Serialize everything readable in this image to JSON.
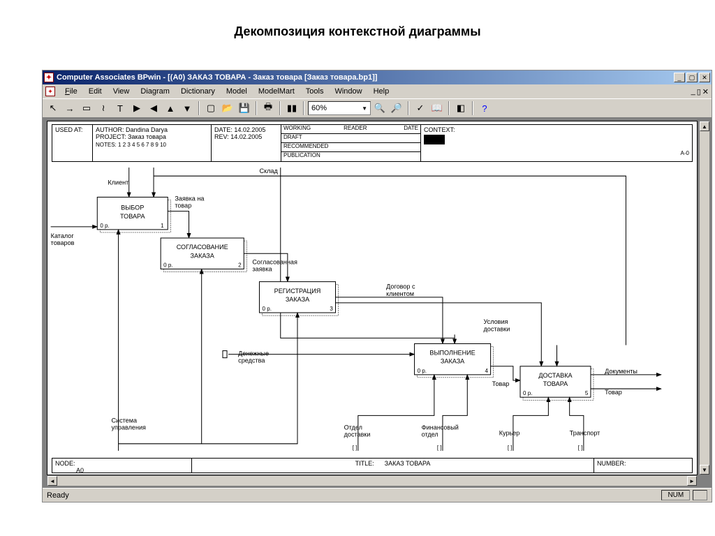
{
  "page_title": "Декомпозиция контекстной диаграммы",
  "titlebar": "Computer Associates BPwin - [(A0) ЗАКАЗ ТОВАРА  - Заказ товара  [Заказ товара.bp1]]",
  "menu": {
    "file": "File",
    "edit": "Edit",
    "view": "View",
    "diagram": "Diagram",
    "dictionary": "Dictionary",
    "model": "Model",
    "modelmart": "ModelMart",
    "tools": "Tools",
    "window": "Window",
    "help": "Help"
  },
  "zoom": "60%",
  "status": {
    "ready": "Ready",
    "num": "NUM"
  },
  "header": {
    "used_at": "USED AT:",
    "author_lbl": "AUTHOR:",
    "author": "Dandina Darya",
    "project_lbl": "PROJECT:",
    "project": "Заказ товара",
    "notes_lbl": "NOTES:",
    "notes": "1  2  3  4  5  6  7  8  9  10",
    "date_lbl": "DATE:",
    "date": "14.02.2005",
    "rev_lbl": "REV:",
    "rev": "14.02.2005",
    "working": "WORKING",
    "draft": "DRAFT",
    "recommended": "RECOMMENDED",
    "publication": "PUBLICATION",
    "reader": "READER",
    "date2": "DATE",
    "context_lbl": "CONTEXT:",
    "context_id": "A-0"
  },
  "footer": {
    "node_lbl": "NODE:",
    "node": "A0",
    "title_lbl": "TITLE:",
    "title": "ЗАКАЗ ТОВАРА",
    "number_lbl": "NUMBER:"
  },
  "boxes": {
    "b1": {
      "title1": "ВЫБОР",
      "title2": "ТОВАРА",
      "cost": "0 р.",
      "num": "1"
    },
    "b2": {
      "title1": "СОГЛАСОВАНИЕ",
      "title2": "ЗАКАЗА",
      "cost": "0 р.",
      "num": "2"
    },
    "b3": {
      "title1": "РЕГИСТРАЦИЯ",
      "title2": "ЗАКАЗА",
      "cost": "0 р.",
      "num": "3"
    },
    "b4": {
      "title1": "ВЫПОЛНЕНИЕ",
      "title2": "ЗАКАЗА",
      "cost": "0 р.",
      "num": "4"
    },
    "b5": {
      "title1": "ДОСТАВКА",
      "title2": "ТОВАРА",
      "cost": "0 р.",
      "num": "5"
    }
  },
  "arrows": {
    "klient": "Клиент",
    "katalog": "Каталог",
    "tovarov": "товаров",
    "zayavka1": "Заявка на",
    "zayavka2": "товар",
    "sklad": "Склад",
    "soglas1": "Согласованная",
    "soglas2": "заявка",
    "dogovor1": "Договор с",
    "dogovor2": "клиентом",
    "usloviya1": "Условия",
    "usloviya2": "доставки",
    "deneg1": "Денежные",
    "deneg2": "средства",
    "tovar_mid": "Товар",
    "dokumenty": "Документы",
    "tovar_out": "Товар",
    "sistema1": "Система",
    "sistema2": "управления",
    "otdel1": "Отдел",
    "otdel2": "доставки",
    "fin1": "Финансовый",
    "fin2": "отдел",
    "kurier": "Курьер",
    "transport": "Транспорт"
  }
}
